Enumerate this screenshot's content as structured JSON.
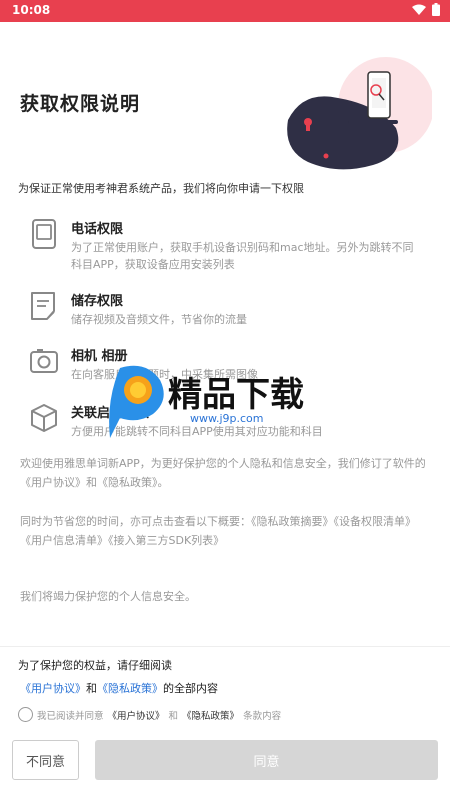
{
  "status_bar": {
    "time": "10:08"
  },
  "title": "获取权限说明",
  "intro": "为保证正常使用考神君系统产品，我们将向你申请一下权限",
  "permissions": [
    {
      "title": "电话权限",
      "desc": "为了正常使用账户，获取手机设备识别码和mac地址。另外为跳转不同科目APP，获取设备应用安装列表",
      "icon": "phone-icon"
    },
    {
      "title": "储存权限",
      "desc": "储存视频及音频文件，节省你的流量",
      "icon": "storage-icon"
    },
    {
      "title": "相机 相册",
      "desc": "在向客服反馈问题时，中采集所需图像",
      "icon": "camera-icon"
    },
    {
      "title": "关联启动权限",
      "desc": "方便用户能跳转不同科目APP使用其对应功能和科目",
      "icon": "cube-icon"
    }
  ],
  "paragraphs": {
    "p1": "欢迎使用雅思单词新APP，为更好保护您的个人隐私和信息安全，我们修订了软件的《用户协议》和《隐私政策》。",
    "p2": "同时为节省您的时间，亦可点击查看以下概要：《隐私政策摘要》《设备权限清单》《用户信息清单》《接入第三方SDK列表》",
    "p3": "我们将竭力保护您的个人信息安全。"
  },
  "footer": {
    "protect_text": "为了保护您的权益，请仔细阅读",
    "user_agreement": "《用户协议》",
    "and": "和",
    "privacy_policy": "《隐私政策》",
    "full_content": "的全部内容",
    "agree_prefix": "我已阅读并同意",
    "agree_user": "《用户协议》",
    "agree_and": "和",
    "agree_privacy": "《隐私政策》",
    "agree_suffix": "条款内容",
    "disagree_label": "不同意",
    "agree_label": "同意"
  },
  "watermark": {
    "text": "精品下载",
    "url": "www.j9p.com"
  },
  "colors": {
    "accent": "#e8404f",
    "link": "#2a73d6",
    "disabled": "#d6d6d6"
  }
}
